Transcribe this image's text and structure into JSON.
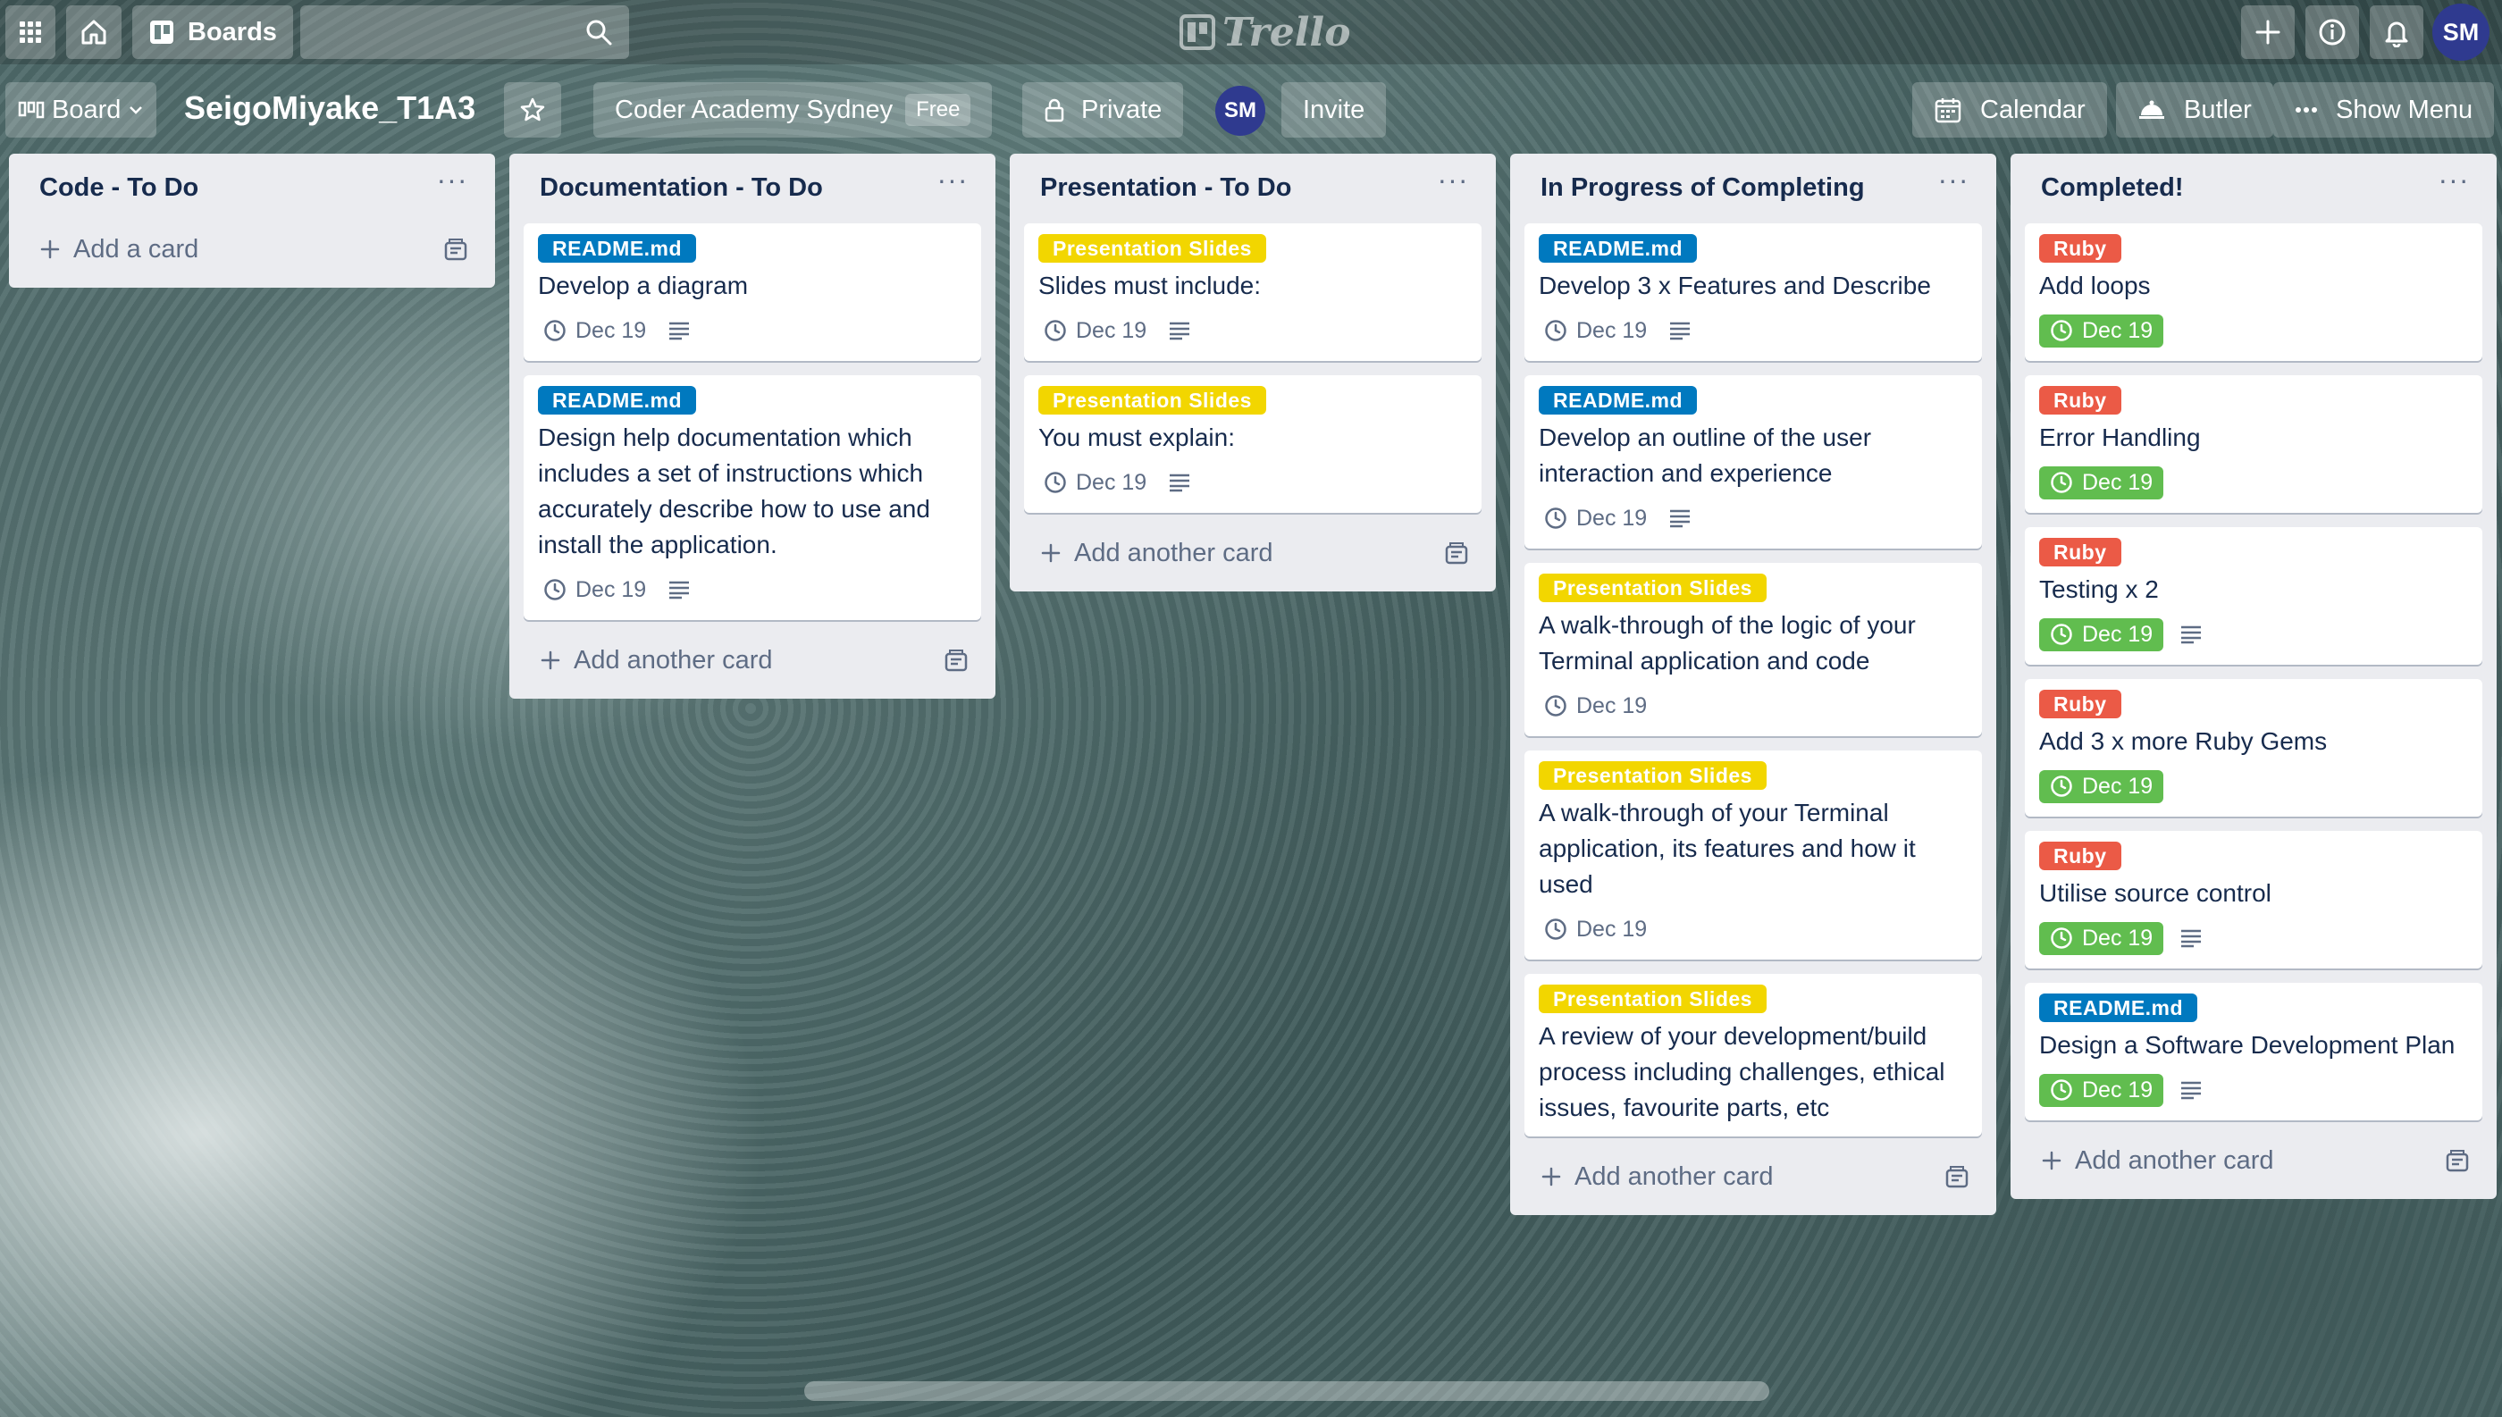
{
  "topbar": {
    "boards_label": "Boards",
    "logo_text": "Trello",
    "user_initials": "SM"
  },
  "boardbar": {
    "view_label": "Board",
    "board_title": "SeigoMiyake_T1A3",
    "workspace": "Coder Academy Sydney",
    "workspace_plan": "Free",
    "visibility": "Private",
    "member_initials": "SM",
    "invite_label": "Invite",
    "calendar_label": "Calendar",
    "butler_label": "Butler",
    "show_menu_label": "Show Menu"
  },
  "lists": [
    {
      "title": "Code - To Do",
      "add_label": "Add a card",
      "cards": []
    },
    {
      "title": "Documentation - To Do",
      "add_label": "Add another card",
      "cards": [
        {
          "label": "README.md",
          "label_color": "blue",
          "title": "Develop a diagram",
          "due": "Dec 19",
          "due_done": false,
          "has_desc": true
        },
        {
          "label": "README.md",
          "label_color": "blue",
          "title": "Design help documentation which includes a set of instructions which accurately describe how to use and install the application.",
          "due": "Dec 19",
          "due_done": false,
          "has_desc": true
        }
      ]
    },
    {
      "title": "Presentation - To Do",
      "add_label": "Add another card",
      "cards": [
        {
          "label": "Presentation Slides",
          "label_color": "yellow",
          "title": "Slides must include:",
          "due": "Dec 19",
          "due_done": false,
          "has_desc": true
        },
        {
          "label": "Presentation Slides",
          "label_color": "yellow",
          "title": "You must explain:",
          "due": "Dec 19",
          "due_done": false,
          "has_desc": true
        }
      ]
    },
    {
      "title": "In Progress of Completing",
      "add_label": "Add another card",
      "cards": [
        {
          "label": "README.md",
          "label_color": "blue",
          "title": "Develop 3 x Features and Describe",
          "due": "Dec 19",
          "due_done": false,
          "has_desc": true
        },
        {
          "label": "README.md",
          "label_color": "blue",
          "title": "Develop an outline of the user interaction and experience",
          "due": "Dec 19",
          "due_done": false,
          "has_desc": true
        },
        {
          "label": "Presentation Slides",
          "label_color": "yellow",
          "title": "A walk-through of the logic of your Terminal application and code",
          "due": "Dec 19",
          "due_done": false,
          "has_desc": false
        },
        {
          "label": "Presentation Slides",
          "label_color": "yellow",
          "title": "A walk-through of your Terminal application, its features and how it used",
          "due": "Dec 19",
          "due_done": false,
          "has_desc": false
        },
        {
          "label": "Presentation Slides",
          "label_color": "yellow",
          "title": "A review of your development/build process including challenges, ethical issues, favourite parts, etc",
          "due": null,
          "due_done": false,
          "has_desc": false
        }
      ]
    },
    {
      "title": "Completed!",
      "add_label": "Add another card",
      "cards": [
        {
          "label": "Ruby",
          "label_color": "red",
          "title": "Add loops",
          "due": "Dec 19",
          "due_done": true,
          "has_desc": false
        },
        {
          "label": "Ruby",
          "label_color": "red",
          "title": "Error Handling",
          "due": "Dec 19",
          "due_done": true,
          "has_desc": false
        },
        {
          "label": "Ruby",
          "label_color": "red",
          "title": "Testing x 2",
          "due": "Dec 19",
          "due_done": true,
          "has_desc": true
        },
        {
          "label": "Ruby",
          "label_color": "red",
          "title": "Add 3 x more Ruby Gems",
          "due": "Dec 19",
          "due_done": true,
          "has_desc": false
        },
        {
          "label": "Ruby",
          "label_color": "red",
          "title": "Utilise source control",
          "due": "Dec 19",
          "due_done": true,
          "has_desc": true
        },
        {
          "label": "README.md",
          "label_color": "blue",
          "title": "Design a Software Development Plan",
          "due": "Dec 19",
          "due_done": true,
          "has_desc": true
        }
      ]
    }
  ]
}
